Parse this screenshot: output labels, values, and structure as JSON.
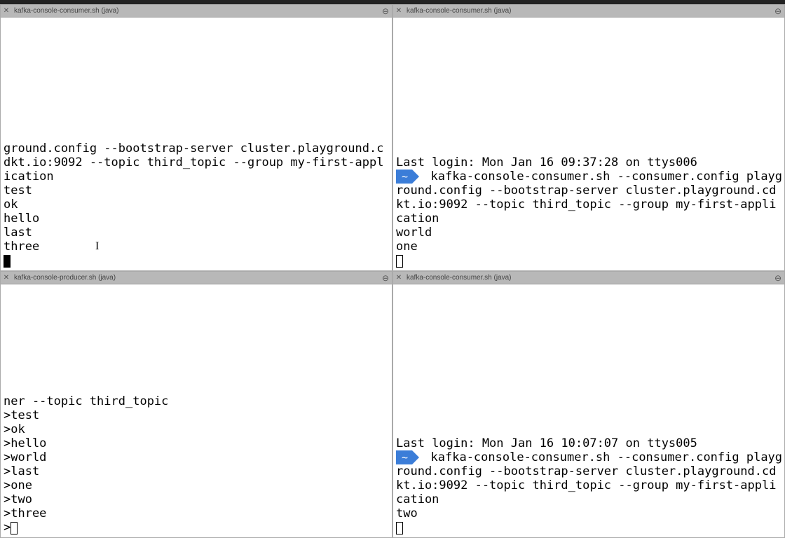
{
  "panes": {
    "tl": {
      "title": "kafka-console-consumer.sh (java)",
      "pre": "ground.config --bootstrap-server cluster.playground.cdkt.io:9092 --topic third_topic --group my-first-application\ntest\nok\nhello\nlast\nthree",
      "cursor": "block",
      "ibeam": true
    },
    "tr": {
      "title": "kafka-console-consumer.sh (java)",
      "login": "Last login: Mon Jan 16 09:37:28 on ttys006",
      "prompt_symbol": "~",
      "cmd": "kafka-console-consumer.sh --consumer.config playground.config --bootstrap-server cluster.playground.cdkt.io:9092 --topic third_topic --group my-first-application",
      "out": "world\none",
      "cursor": "outline"
    },
    "bl": {
      "title": "kafka-console-producer.sh (java)",
      "pre": "ner --topic third_topic\n>test\n>ok\n>hello\n>world\n>last\n>one\n>two\n>three",
      "prompt_char": ">",
      "cursor": "outline"
    },
    "br": {
      "title": "kafka-console-consumer.sh (java)",
      "login": "Last login: Mon Jan 16 10:07:07 on ttys005",
      "prompt_symbol": "~",
      "cmd": "kafka-console-consumer.sh --consumer.config playground.config --bootstrap-server cluster.playground.cdkt.io:9092 --topic third_topic --group my-first-application",
      "out": "two",
      "cursor": "outline"
    }
  }
}
